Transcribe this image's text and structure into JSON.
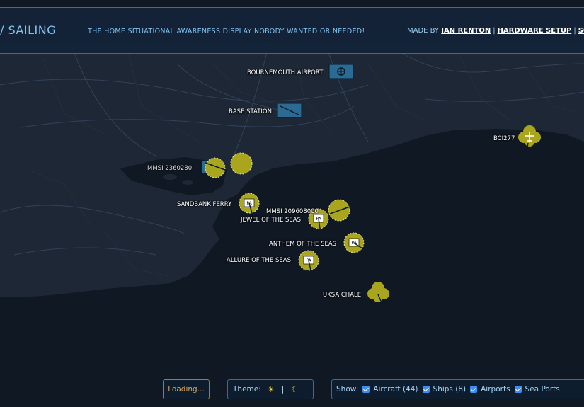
{
  "header": {
    "title": "/ SAILING",
    "tagline": "THE HOME SITUATIONAL AWARENESS DISPLAY NOBODY WANTED OR NEEDED!",
    "made_by": "MADE BY",
    "author_link": "IAN RENTON",
    "hardware_link": "HARDWARE SETUP",
    "source_link": "SOU"
  },
  "map_labels": {
    "bournemouth_airport": "BOURNEMOUTH AIRPORT",
    "base_station": "BASE STATION",
    "bci277": "BCI277",
    "overlap": "MMSI 2360280",
    "sandbank_ferry": "SANDBANK FERRY",
    "mmsi": "MMSI 209608000",
    "jewel": "JEWEL OF THE SEAS",
    "anthem": "ANTHEM OF THE SEAS",
    "allure": "ALLURE OF THE SEAS",
    "uksa": "UKSA CHALE"
  },
  "controls": {
    "loading": "Loading...",
    "theme_label": "Theme:",
    "theme_sep": "|",
    "show_label": "Show:",
    "aircraft": "Aircraft (44)",
    "ships": "Ships (8)",
    "airports": "Airports",
    "seaports": "Sea Ports"
  },
  "colors": {
    "track_fill": "#a9a51c",
    "accent": "#7fc2f0",
    "sea": "#101823",
    "land": "#1e2838"
  }
}
